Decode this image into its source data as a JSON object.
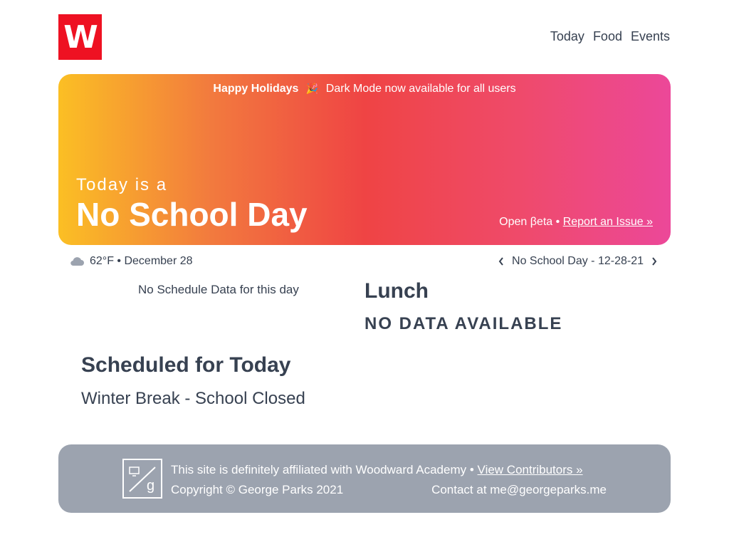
{
  "header": {
    "logo_text": "W",
    "nav": [
      "Today",
      "Food",
      "Events"
    ]
  },
  "hero": {
    "announce_bold": "Happy Holidays",
    "announce_emoji": "🎉",
    "announce_text": "Dark Mode now available for all users",
    "today_is": "Today is a",
    "day_type": "No School Day",
    "beta_text": "Open βeta •",
    "report_link": "Report an Issue »",
    "gradient_colors": [
      "#fbbf24",
      "#ef4444",
      "#ec4899"
    ]
  },
  "info_bar": {
    "weather_icon": "cloud-icon",
    "weather": "62°F • December 28",
    "day_label": "No School Day - 12-28-21"
  },
  "schedule": {
    "empty_text": "No Schedule Data for this day",
    "scheduled_title": "Scheduled for Today",
    "scheduled_item": "Winter Break - School Closed"
  },
  "lunch": {
    "title": "Lunch",
    "status": "NO DATA AVAILABLE"
  },
  "footer": {
    "affiliation": "This site is definitely affiliated with Woodward Academy •",
    "contributors_link": "View Contributors »",
    "copyright": "Copyright © George Parks 2021",
    "contact": "Contact at me@georgeparks.me"
  },
  "colors": {
    "brand_red": "#ee1122",
    "text": "#374151",
    "footer_bg": "#9ca3af"
  }
}
